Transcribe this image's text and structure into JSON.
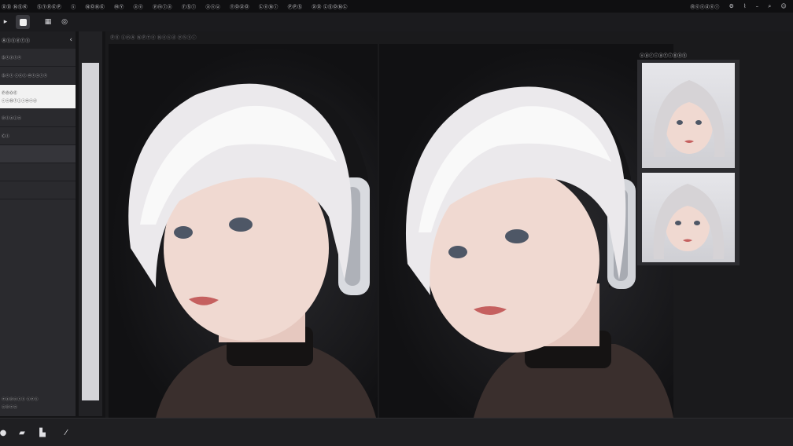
{
  "menubar": {
    "items": [
      "Ⓧ⓪ ⓃⓈⓀ",
      "ⓈⓉⓇⒺⓅ",
      "ⓢ",
      "ⓃⓄⓃⒺ",
      "ⓂⓎ",
      "ⓐⓔ",
      "ⓟⓜⓛⓐ",
      "ⓉⓈⓛ",
      "ⓐⓝⓤ",
      "ⓉⓄⓊⓄ",
      "ⓁⓔⓃⓘ",
      "ⓅⓅⓈ",
      "ⓍⓄ ⓁⓈⓄⓃⓁ"
    ],
    "right_label": "Ⓡⓔⓝⓓⓔⓡ",
    "right_icons": [
      "settings-icon",
      "wifi-icon",
      "minimize-icon",
      "search-icon",
      "user-icon"
    ]
  },
  "toolbar": {
    "icons": [
      "play-icon",
      "square-icon",
      "grid-icon",
      "camera-icon"
    ]
  },
  "left_panel": {
    "header": "Ⓐⓢⓢⓔⓣⓢ",
    "rows": [
      {
        "label": "Ⓢⓣⓨⓛⓔ"
      },
      {
        "label": "Ⓢⓔⓣ ⓒⓞⓛ ⓜⓣⓤⓡⓔ"
      },
      {
        "label": "ⓅⓇⓄⒺ",
        "sublabel": "ⓒⓞⓃⓕⓘⓡⓜⓔⓓ"
      },
      {
        "label": "ⓟⓛⓐⓘⓝ"
      },
      {
        "label": "Ⓒⓛ"
      },
      {
        "label": ""
      },
      {
        "label": ""
      },
      {
        "label": ""
      }
    ],
    "footer_lines": [
      "ⓔⓧⓟⓞⓡⓣ ⓢⓔⓣ",
      "ⓞⓟⓔⓝ"
    ]
  },
  "workspace": {
    "caption": "ⓅⓍ ⓁⓜⒶ ⓃⓅⓉⓔ Ⓝⓔⓝⓓ ⓟⓗⓢⓘ"
  },
  "thumbnails": {
    "label": "ⓥⓐⓡⓘⓐⓣⓘⓞⓝⓢ",
    "items": [
      "variation-1",
      "variation-2"
    ]
  },
  "bottombar": {
    "icons": [
      "select-icon",
      "chat-icon",
      "library-icon",
      "brush-icon"
    ]
  },
  "colors": {
    "background": "#141416",
    "panel": "#2a2a2e",
    "selected_row": "#f2f2f2",
    "scroll_thumb": "#d4d4d8"
  }
}
